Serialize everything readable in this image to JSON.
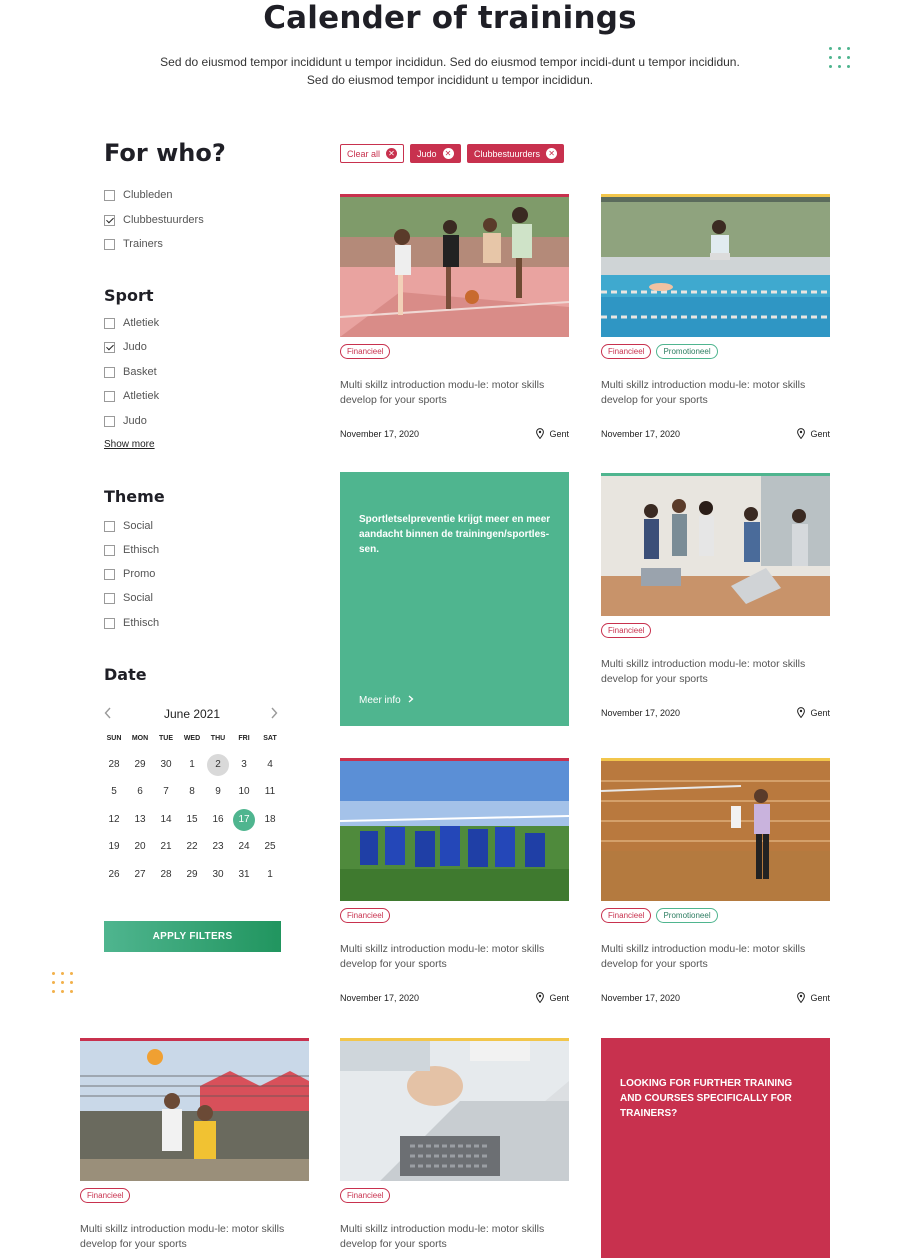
{
  "header": {
    "title": "Calender of trainings",
    "subtitle": "Sed do eiusmod tempor incididunt u tempor incididun. Sed do eiusmod tempor incidi-dunt u tempor incididun. Sed do eiusmod tempor incididunt u tempor incididun."
  },
  "filters": {
    "for_who": {
      "title": "For who?",
      "options": [
        {
          "label": "Clubleden",
          "checked": false
        },
        {
          "label": "Clubbestuurders",
          "checked": true
        },
        {
          "label": "Trainers",
          "checked": false
        }
      ]
    },
    "sport": {
      "title": "Sport",
      "options": [
        {
          "label": "Atletiek",
          "checked": false
        },
        {
          "label": "Judo",
          "checked": true
        },
        {
          "label": "Basket",
          "checked": false
        },
        {
          "label": "Atletiek",
          "checked": false
        },
        {
          "label": "Judo",
          "checked": false
        }
      ],
      "show_more": "Show more"
    },
    "theme": {
      "title": "Theme",
      "options": [
        {
          "label": "Social",
          "checked": false
        },
        {
          "label": "Ethisch",
          "checked": false
        },
        {
          "label": "Promo",
          "checked": false
        },
        {
          "label": "Social",
          "checked": false
        },
        {
          "label": "Ethisch",
          "checked": false
        }
      ]
    },
    "date": {
      "title": "Date",
      "calendar": {
        "month": "June 2021",
        "prev_icon": "chevron-left-icon",
        "next_icon": "chevron-right-icon",
        "weekdays": [
          "SUN",
          "MON",
          "TUE",
          "WED",
          "THU",
          "FRI",
          "SAT"
        ],
        "weeks": [
          [
            "28",
            "29",
            "30",
            "1",
            "2",
            "3",
            "4"
          ],
          [
            "5",
            "6",
            "7",
            "8",
            "9",
            "10",
            "11"
          ],
          [
            "12",
            "13",
            "14",
            "15",
            "16",
            "17",
            "18"
          ],
          [
            "19",
            "20",
            "21",
            "22",
            "23",
            "24",
            "25"
          ],
          [
            "26",
            "27",
            "28",
            "29",
            "30",
            "31",
            "1"
          ]
        ],
        "today": "2",
        "selected": "17"
      }
    },
    "apply_label": "APPLY FILTERS"
  },
  "active_filters": {
    "clear_all": "Clear all",
    "chips": [
      "Judo",
      "Clubbestuurders"
    ]
  },
  "cards": [
    {
      "bar_color": "#c8314e",
      "image": "basketball-photo",
      "tags": [
        "Financieel"
      ],
      "description": "Multi skillz introduction modu-le: motor skills develop for your sports",
      "date": "November 17, 2020",
      "location": "Gent"
    },
    {
      "bar_color": "#f2c64b",
      "image": "swimming-pool-photo",
      "tags": [
        "Financieel",
        "Promotioneel"
      ],
      "description": "Multi skillz introduction modu-le: motor skills develop for your sports",
      "date": "November 17, 2020",
      "location": "Gent"
    },
    {
      "bar_color": "#4fb58f",
      "image": "meeting-room-photo",
      "tags": [
        "Financieel"
      ],
      "description": "Multi skillz introduction modu-le: motor skills develop for your sports",
      "date": "November 17, 2020",
      "location": "Gent"
    },
    {
      "bar_color": "#c8314e",
      "image": "football-team-photo",
      "tags": [
        "Financieel"
      ],
      "description": "Multi skillz introduction modu-le: motor skills develop for your sports",
      "date": "November 17, 2020",
      "location": "Gent"
    },
    {
      "bar_color": "#f2c64b",
      "image": "badminton-gym-photo",
      "tags": [
        "Financieel",
        "Promotioneel"
      ],
      "description": "Multi skillz introduction modu-le: motor skills develop for your sports",
      "date": "November 17, 2020",
      "location": "Gent"
    },
    {
      "bar_color": "#c8314e",
      "image": "volleyball-photo",
      "tags": [
        "Financieel"
      ],
      "description": "Multi skillz introduction modu-le: motor skills develop for your sports"
    },
    {
      "bar_color": "#f2c64b",
      "image": "laptop-desk-photo",
      "tags": [
        "Financieel"
      ],
      "description": "Multi skillz introduction modu-le: motor skills develop for your sports"
    }
  ],
  "promo_card": {
    "text": "Sportletselpreventie krijgt meer en meer aandacht binnen de trainingen/sportles- sen.",
    "link": "Meer info"
  },
  "cta_card": {
    "text": "LOOKING FOR FURTHER TRAINING AND COURSES SPECIFICALLY FOR TRAINERS?"
  },
  "colors": {
    "accent_green": "#4fb58f",
    "accent_red": "#c8314e",
    "accent_yellow": "#f2c64b"
  }
}
